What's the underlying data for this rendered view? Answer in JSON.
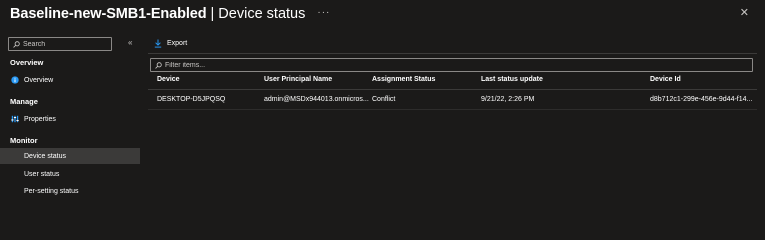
{
  "header": {
    "title": "Baseline-new-SMB1-Enabled",
    "subtitle": "| Device status",
    "more": "···",
    "close": "✕"
  },
  "sidebar": {
    "search_placeholder": "Search",
    "collapse": "«",
    "sections": {
      "overview": "Overview",
      "manage": "Manage",
      "monitor": "Monitor"
    },
    "items": {
      "overview": "Overview",
      "properties": "Properties",
      "device_status": "Device status",
      "user_status": "User status",
      "per_setting_status": "Per-setting status"
    },
    "selected": "device_status"
  },
  "toolbar": {
    "export_label": "Export"
  },
  "filter": {
    "placeholder": "Filter items..."
  },
  "table": {
    "columns": [
      "Device",
      "User Principal Name",
      "Assignment Status",
      "Last status update",
      "Device Id"
    ],
    "rows": [
      [
        "DESKTOP-D5JPQSQ",
        "admin@MSDx944013.onmicros...",
        "Conflict",
        "9/21/22, 2:26 PM",
        "d8b712c1-299e-456e-9d44-f14..."
      ]
    ]
  },
  "colors": {
    "background": "#1b1a19",
    "selected_nav": "#3b3a39",
    "border": "#8a8886",
    "accent": "#2899f5"
  }
}
